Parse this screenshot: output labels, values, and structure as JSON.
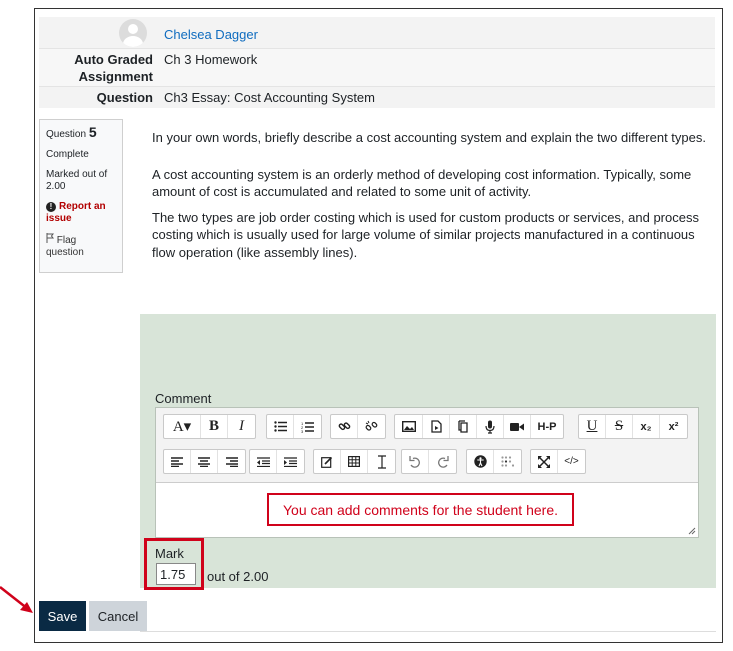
{
  "header": {
    "student_name": "Chelsea Dagger",
    "assignment_label": "Auto Graded Assignment",
    "assignment_value": "Ch 3 Homework",
    "question_label": "Question",
    "question_value": "Ch3 Essay: Cost Accounting System"
  },
  "info": {
    "question_prefix": "Question",
    "question_number": "5",
    "status": "Complete",
    "marked_out_of": "Marked out of 2.00",
    "report": "Report an issue",
    "flag": "Flag question"
  },
  "question": {
    "prompt": "In your own words, briefly describe a cost accounting system and explain the two different types.",
    "answer_p1": "A cost accounting system is an orderly method of developing cost information. Typically, some amount of cost is accumulated and related to some unit of activity.",
    "answer_p2": "The two types are job order costing which is used for custom products or services, and process costing which is usually used for large volume of similar projects manufactured in a continuous flow operation (like assembly lines)."
  },
  "comment": {
    "label": "Comment",
    "callout": "You can add comments for the student here.",
    "toolbar_row1": [
      {
        "icon": "font-color-icon",
        "text": "A▾"
      },
      {
        "icon": "bold-icon",
        "text": "B"
      },
      {
        "icon": "italic-icon",
        "text": "I"
      },
      {
        "icon": "unordered-list-icon",
        "text": ""
      },
      {
        "icon": "ordered-list-icon",
        "text": ""
      },
      {
        "icon": "link-icon",
        "text": ""
      },
      {
        "icon": "unlink-icon",
        "text": ""
      },
      {
        "icon": "image-icon",
        "text": ""
      },
      {
        "icon": "media-icon",
        "text": ""
      },
      {
        "icon": "manage-files-icon",
        "text": ""
      },
      {
        "icon": "record-audio-icon",
        "text": ""
      },
      {
        "icon": "record-video-icon",
        "text": ""
      },
      {
        "icon": "h5p-icon",
        "text": "H-P"
      },
      {
        "icon": "underline-icon",
        "text": "U"
      },
      {
        "icon": "strikethrough-icon",
        "text": "S"
      },
      {
        "icon": "subscript-icon",
        "text": "x₂"
      },
      {
        "icon": "superscript-icon",
        "text": "x²"
      }
    ],
    "toolbar_row2": [
      {
        "icon": "align-left-icon"
      },
      {
        "icon": "align-center-icon"
      },
      {
        "icon": "align-right-icon"
      },
      {
        "icon": "outdent-icon"
      },
      {
        "icon": "indent-icon"
      },
      {
        "icon": "equation-icon"
      },
      {
        "icon": "table-icon"
      },
      {
        "icon": "clear-formatting-icon"
      },
      {
        "icon": "undo-icon"
      },
      {
        "icon": "redo-icon"
      },
      {
        "icon": "accessibility-checker-icon"
      },
      {
        "icon": "screenreader-helper-icon"
      },
      {
        "icon": "fullscreen-icon"
      },
      {
        "icon": "html-icon",
        "text": "</>"
      }
    ]
  },
  "mark": {
    "label": "Mark",
    "value": "1.75",
    "out_of": "out of 2.00"
  },
  "buttons": {
    "save": "Save",
    "cancel": "Cancel"
  },
  "colors": {
    "link": "#0f6cbf",
    "panel": "#d8e4d8",
    "save_button": "#0a2a44",
    "annotation_red": "#d0021b"
  }
}
